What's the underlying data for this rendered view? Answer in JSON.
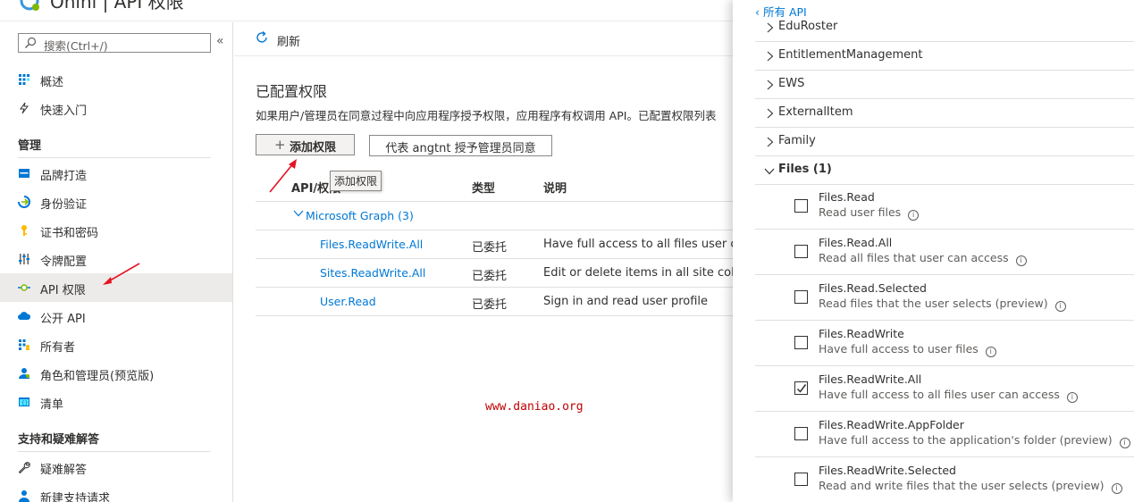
{
  "header": {
    "title": "Onini | API 权限"
  },
  "sidebar": {
    "search_placeholder": "搜索(Ctrl+/)",
    "collapse_glyph": "«",
    "top_items": [
      {
        "label": "概述",
        "icon": "grid-icon"
      },
      {
        "label": "快速入门",
        "icon": "lightning-icon"
      }
    ],
    "section_manage": "管理",
    "manage_items": [
      {
        "label": "品牌打造",
        "icon": "branding-icon"
      },
      {
        "label": "身份验证",
        "icon": "authentication-icon"
      },
      {
        "label": "证书和密码",
        "icon": "key-icon"
      },
      {
        "label": "令牌配置",
        "icon": "token-config-icon"
      },
      {
        "label": "API 权限",
        "icon": "api-permissions-icon",
        "active": true
      },
      {
        "label": "公开 API",
        "icon": "cloud-icon"
      },
      {
        "label": "所有者",
        "icon": "owners-icon"
      },
      {
        "label": "角色和管理员(预览版)",
        "icon": "roles-icon"
      },
      {
        "label": "清单",
        "icon": "manifest-icon"
      }
    ],
    "section_support": "支持和疑难解答",
    "support_items": [
      {
        "label": "疑难解答",
        "icon": "wrench-icon"
      },
      {
        "label": "新建支持请求",
        "icon": "support-person-icon"
      }
    ]
  },
  "toolbar": {
    "refresh_label": "刷新"
  },
  "main": {
    "title": "已配置权限",
    "description": "如果用户/管理员在同意过程中向应用程序授予权限，应用程序有权调用 API。已配置权限列表",
    "add_button": "添加权限",
    "consent_button": "代表 angtnt 授予管理员同意",
    "tooltip": "添加权限",
    "columns": {
      "api": "API/权限",
      "type": "类型",
      "desc": "说明"
    },
    "group": "Microsoft Graph (3)",
    "rows": [
      {
        "name": "Files.ReadWrite.All",
        "type": "已委托",
        "desc": "Have full access to all files user can ac"
      },
      {
        "name": "Sites.ReadWrite.All",
        "type": "已委托",
        "desc": "Edit or delete items in all site collectio"
      },
      {
        "name": "User.Read",
        "type": "已委托",
        "desc": "Sign in and read user profile"
      }
    ]
  },
  "watermark": "www.daniao.org",
  "panel": {
    "back_label": "所有 API",
    "apis": [
      "EduRoster",
      "EntitlementManagement",
      "EWS",
      "ExternalItem",
      "Family"
    ],
    "expanded_api": "Files (1)",
    "permissions": [
      {
        "name": "Files.Read",
        "desc": "Read user files",
        "checked": false
      },
      {
        "name": "Files.Read.All",
        "desc": "Read all files that user can access",
        "checked": false
      },
      {
        "name": "Files.Read.Selected",
        "desc": "Read files that the user selects (preview)",
        "checked": false
      },
      {
        "name": "Files.ReadWrite",
        "desc": "Have full access to user files",
        "checked": false
      },
      {
        "name": "Files.ReadWrite.All",
        "desc": "Have full access to all files user can access",
        "checked": true
      },
      {
        "name": "Files.ReadWrite.AppFolder",
        "desc": "Have full access to the application's folder (preview)",
        "checked": false
      },
      {
        "name": "Files.ReadWrite.Selected",
        "desc": "Read and write files that the user selects (preview)",
        "checked": false
      }
    ],
    "info_glyph": "i"
  },
  "colors": {
    "accent": "#0078d4",
    "annotation_arrow": "#e81123",
    "watermark": "#c00000",
    "active_nav": "#edebe9"
  }
}
